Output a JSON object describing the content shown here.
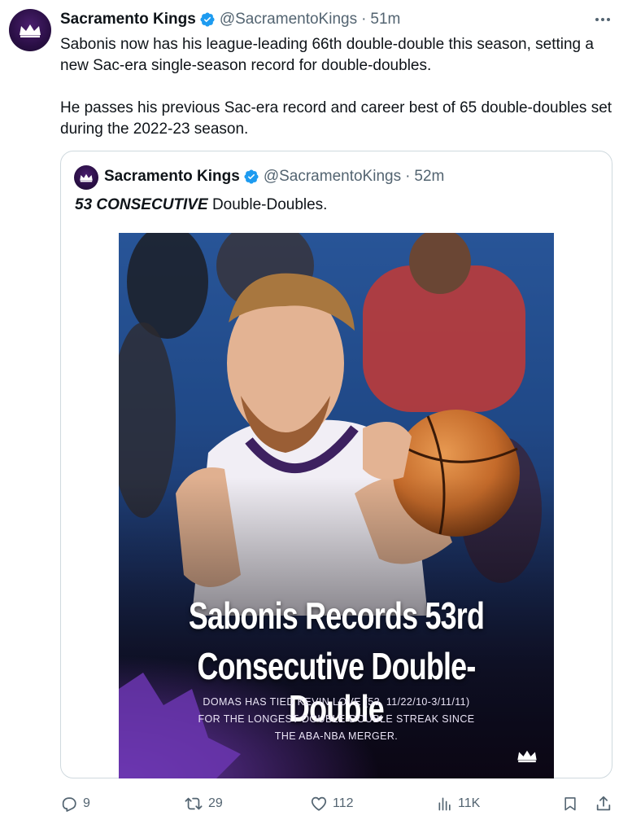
{
  "tweet": {
    "author_name": "Sacramento Kings",
    "handle": "@SacramentoKings",
    "time": "51m",
    "paragraphs": [
      "Sabonis now has his league-leading 66th double-double this season, setting a new Sac-era single-season record for double-doubles.",
      "He passes his previous Sac-era record and career best of 65 double-doubles set during the 2022-23 season."
    ]
  },
  "quoted": {
    "author_name": "Sacramento Kings",
    "handle": "@SacramentoKings",
    "time": "52m",
    "text_emphasis": "53 CONSECUTIVE",
    "text_rest": "Double-Doubles.",
    "graphic": {
      "title_line1": "Sabonis Records 53rd",
      "title_line2": "Consecutive Double-Double",
      "sub_line1": "DOMAS HAS TIED KEVIN LOVE (53, 11/22/10-3/11/11)",
      "sub_line2": "FOR THE LONGEST DOUBLE-DOUBLE STREAK SINCE",
      "sub_line3": "THE ABA-NBA MERGER."
    }
  },
  "actions": {
    "replies": "9",
    "reposts": "29",
    "likes": "112",
    "views": "11K"
  },
  "icons": {
    "verified": "verified-badge-icon",
    "more": "more-icon",
    "reply": "reply-icon",
    "repost": "repost-icon",
    "like": "heart-icon",
    "views": "views-icon",
    "bookmark": "bookmark-icon",
    "share": "share-icon",
    "avatar_logo": "crown-icon"
  },
  "colors": {
    "verified_blue": "#1d9bf0",
    "text_primary": "#0f1419",
    "text_muted": "#536471",
    "border": "#cfd9de",
    "kings_purple": "#5a2d81"
  }
}
